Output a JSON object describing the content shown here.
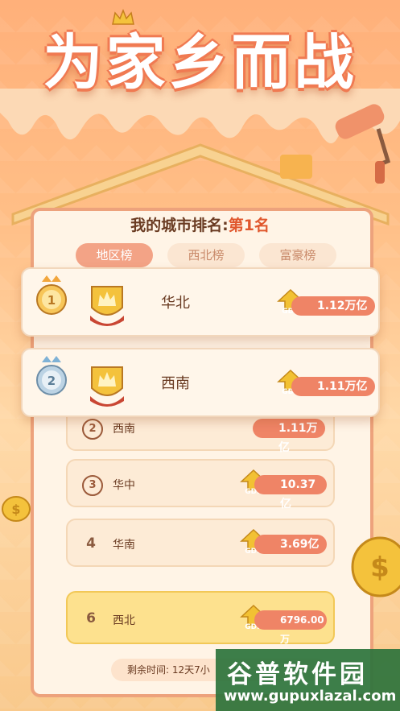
{
  "title": "为家乡而战",
  "rank_prefix": "我的城市排名:",
  "rank_value": "第1名",
  "tabs": [
    {
      "label": "地区榜"
    },
    {
      "label": "西北榜"
    },
    {
      "label": "富豪榜"
    }
  ],
  "top_cards": [
    {
      "rank": "1",
      "city": "华北",
      "gdp": "1.12万亿",
      "gdp_tag": "GDP"
    },
    {
      "rank": "2",
      "city": "西南",
      "gdp": "1.11万亿",
      "gdp_tag": "GDP"
    }
  ],
  "list": [
    {
      "rank": "2",
      "city": "西南",
      "gdp": "1.11万亿",
      "gdp_tag": "GDP"
    },
    {
      "rank": "3",
      "city": "华中",
      "gdp": "10.37亿",
      "gdp_tag": "GDP"
    },
    {
      "rank": "4",
      "city": "华南",
      "gdp": "3.69亿",
      "gdp_tag": "GDP"
    },
    {
      "rank": "6",
      "city": "西北",
      "gdp": "6796.00万",
      "gdp_tag": "GDP"
    }
  ],
  "footer": {
    "remaining": "剩余时间:  12天7小"
  },
  "watermark": {
    "title": "谷普软件园",
    "url": "www.gupuxlazal.com"
  },
  "colors": {
    "accent": "#ef8466",
    "highlight": "#e0572d",
    "gold": "#f2c857"
  }
}
